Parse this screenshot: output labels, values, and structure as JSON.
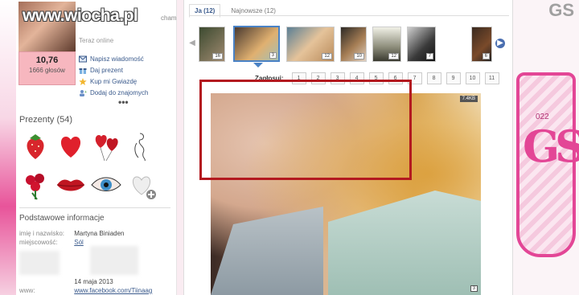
{
  "watermark": "www.wiocha.pl",
  "profile": {
    "score": "10,76",
    "votes": "1666 głosów",
    "cham_text": "cham",
    "status": "Teraz online",
    "actions": [
      {
        "label": "Napisz wiadomość",
        "icon": "envelope-icon"
      },
      {
        "label": "Daj prezent",
        "icon": "gift-icon"
      },
      {
        "label": "Kup mi Gwiazdę",
        "icon": "star-icon"
      },
      {
        "label": "Dodaj do znajomych",
        "icon": "add-friend-icon"
      }
    ],
    "more": "•••"
  },
  "gifts": {
    "title": "Prezenty (54)",
    "items": [
      "strawberry-icon",
      "heart-icon",
      "balloon-hearts-icon",
      "figure-sketch-icon",
      "rose-bouquet-icon",
      "lips-icon",
      "eye-icon",
      "add-gift-icon"
    ]
  },
  "info": {
    "title": "Podstawowe informacje",
    "name_key": "imię i nazwisko:",
    "name_val": "Martyna Biniaden",
    "city_key": "miejscowość:",
    "city_val": "Sól",
    "date_val": "14 maja 2013",
    "www_key": "www:",
    "www_val": "www.facebook.com/Tiinaag"
  },
  "tabs": [
    {
      "label": "Ja (12)",
      "active": true
    },
    {
      "label": "Najnowsze (12)",
      "active": false
    }
  ],
  "thumbnails": [
    {
      "badge": "16"
    },
    {
      "badge": "3",
      "active": true
    },
    {
      "badge": "12"
    },
    {
      "badge": "10"
    },
    {
      "badge": "12"
    },
    {
      "badge": "7"
    },
    {
      "badge": "6"
    }
  ],
  "pager": {
    "label": "Zagłosuj:",
    "pages": [
      "1",
      "2",
      "3",
      "4",
      "5",
      "6",
      "7",
      "8",
      "9",
      "10",
      "11"
    ]
  },
  "photo": {
    "size_badge": "7.4KB",
    "corner_badge": "3"
  },
  "decor": {
    "crest_text": "GS",
    "crest_num": "022",
    "corner_text": "GS"
  },
  "colors": {
    "highlight": "#b3191f",
    "link": "#3a5a8c",
    "score_bg": "#f7b7bf",
    "accent_pink": "#e34696"
  }
}
